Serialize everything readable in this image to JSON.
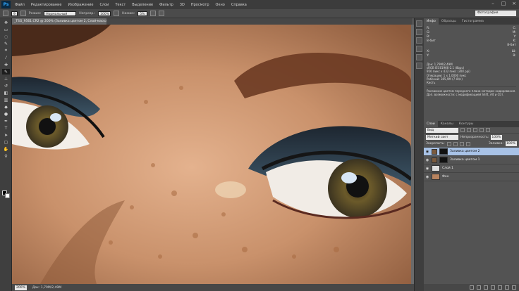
{
  "app": {
    "logo": "Ps"
  },
  "menu": [
    "Файл",
    "Редактирование",
    "Изображение",
    "Слои",
    "Текст",
    "Выделение",
    "Фильтр",
    "3D",
    "Просмотр",
    "Окно",
    "Справка"
  ],
  "window_controls": [
    "–",
    "□",
    "×"
  ],
  "options": {
    "brush_size": "9",
    "mode_label": "Режим:",
    "mode_value": "Нормальный",
    "opacity_label": "Непрозр.:",
    "opacity_value": "100%",
    "flow_label": "Нажим:",
    "flow_value": "5%",
    "workspace": "Фотография"
  },
  "document": {
    "tab_title": "_TSG_9561.CR2 @ 200% (Заливка цветом 2, Слой-маска/8) *",
    "zoom": "200%",
    "doc_info": "Док: 1,79M/2,49M"
  },
  "panel_tabs": [
    "Инфо",
    "Образцы",
    "Гистограмма"
  ],
  "info": {
    "r_label": "R:",
    "g_label": "G:",
    "b_label": "B:",
    "c_label": "C:",
    "m_label": "M:",
    "y_label": "Y:",
    "k_label": "K:",
    "bit1": "8-бит",
    "bit2": "8-бит",
    "x_label": "X:",
    "y2_label": "Y:",
    "w_label": "Ш:",
    "h_label": "В:",
    "details": [
      "Док: 1,79M/2,49M",
      "sRGB IEC61966-2.1 (8bpc)",
      "956 пикс x 432 пикс (300 ppi)",
      "Операции: 1 x 1,0000 пикс",
      "Рабочий: 365,9M (7 Ю/с)",
      "Кисть"
    ],
    "tip": "Рисование цветом переднего плана методом кодирования. Доп. возможности: с модификацией Shift, Alt и Ctrl."
  },
  "layers": {
    "tabs": [
      "Слои",
      "Каналы",
      "Контуры"
    ],
    "kind": "Вид",
    "blend": "Мягкий свет",
    "opacity_label": "Непрозрачность:",
    "opacity": "100%",
    "lock_label": "Закрепить:",
    "fill_label": "Заливка:",
    "fill": "100%",
    "items": [
      {
        "name": "Заливка цветом 2",
        "selected": true
      },
      {
        "name": "Заливка цветом 1",
        "selected": false
      },
      {
        "name": "Слой 1",
        "selected": false
      },
      {
        "name": "Фон",
        "selected": false
      }
    ]
  },
  "colors": {
    "selection": "#a8c2e6",
    "ui_dark": "#535353"
  }
}
